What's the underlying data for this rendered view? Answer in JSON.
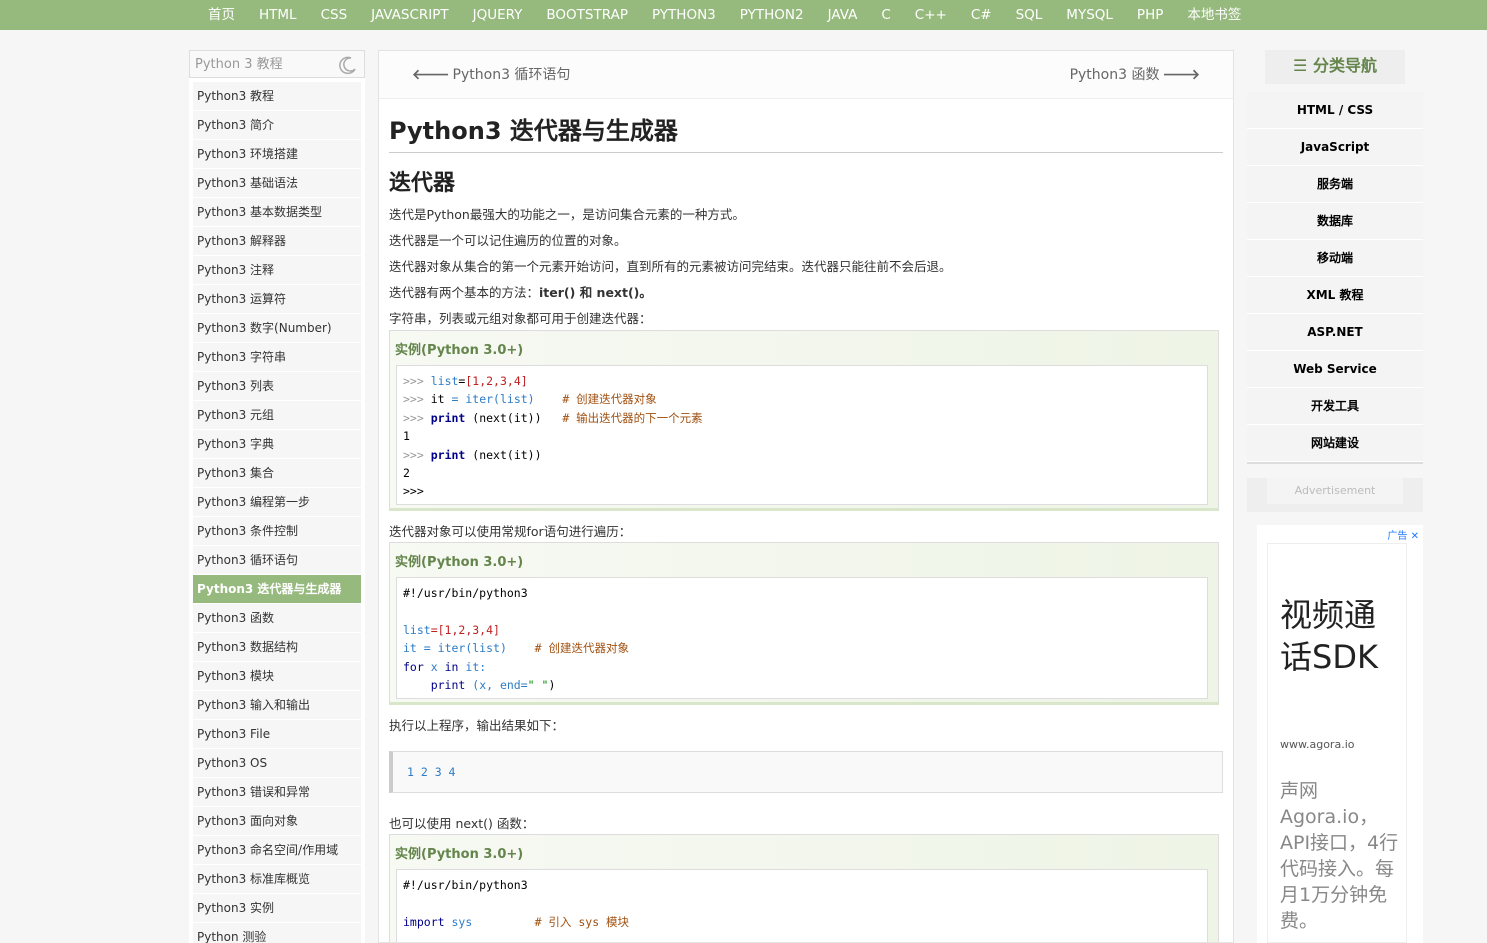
{
  "topnav": [
    "首页",
    "HTML",
    "CSS",
    "JAVASCRIPT",
    "JQUERY",
    "BOOTSTRAP",
    "PYTHON3",
    "PYTHON2",
    "JAVA",
    "C",
    "C++",
    "C#",
    "SQL",
    "MYSQL",
    "PHP",
    "本地书签"
  ],
  "sidebar": {
    "title": "Python 3 教程",
    "items": [
      "Python3 教程",
      "Python3 简介",
      "Python3 环境搭建",
      "Python3 基础语法",
      "Python3 基本数据类型",
      "Python3 解释器",
      "Python3 注释",
      "Python3 运算符",
      "Python3 数字(Number)",
      "Python3 字符串",
      "Python3 列表",
      "Python3 元组",
      "Python3 字典",
      "Python3 集合",
      "Python3 编程第一步",
      "Python3 条件控制",
      "Python3 循环语句",
      "Python3 迭代器与生成器",
      "Python3 函数",
      "Python3 数据结构",
      "Python3 模块",
      "Python3 输入和输出",
      "Python3 File",
      "Python3 OS",
      "Python3 错误和异常",
      "Python3 面向对象",
      "Python3 命名空间/作用域",
      "Python3 标准库概览",
      "Python3 实例",
      "Python 测验"
    ],
    "active_index": 17
  },
  "main": {
    "prev": "Python3 循环语句",
    "next": "Python3 函数",
    "title": "Python3 迭代器与生成器",
    "section": "迭代器",
    "p1": "迭代是Python最强大的功能之一，是访问集合元素的一种方式。",
    "p2": "迭代器是一个可以记住遍历的位置的对象。",
    "p3": "迭代器对象从集合的第一个元素开始访问，直到所有的元素被访问完结束。迭代器只能往前不会后退。",
    "p4_prefix": "迭代器有两个基本的方法：",
    "p4_bold": "iter() 和 next()。",
    "p5": "字符串，列表或元组对象都可用于创建迭代器：",
    "example_label": "实例(Python 3.0+)",
    "p6": "迭代器对象可以使用常规for语句进行遍历：",
    "p7": "执行以上程序，输出结果如下：",
    "output": "1 2 3 4",
    "p8": "也可以使用 next() 函数："
  },
  "code1": {
    "prompt": ">>>",
    "l1_var": "list",
    "l1_eq": "=",
    "l1_list": "[1,2,3,4]",
    "l2_it": "it",
    "l2_rest": "= iter(list)",
    "l2_cm": "# 创建迭代器对象",
    "l3_kw": "print",
    "l3_rest": "(next(it))",
    "l3_cm": "# 输出迭代器的下一个元素",
    "out1": "1",
    "l5_kw": "print",
    "l5_rest": "(next(it))",
    "out2": "2"
  },
  "code2": {
    "shebang": "#!/usr/bin/python3",
    "l2_var": "list",
    "l2_list": "=[1,2,3,4]",
    "l3_it": "it",
    "l3_rest": "= iter(list)",
    "l3_cm": "# 创建迭代器对象",
    "l4_for": "for",
    "l4_x": "x",
    "l4_in": "in",
    "l4_it": "it:",
    "l5_print": "print",
    "l5_args": "(x, end=",
    "l5_str": "\" \"",
    "l5_close": ")"
  },
  "code3": {
    "shebang": "#!/usr/bin/python3",
    "l2_import": "import",
    "l2_sys": "sys",
    "l2_cm": "# 引入 sys 模块"
  },
  "rside": {
    "nav_title": "分类导航",
    "nav_items": [
      "HTML / CSS",
      "JavaScript",
      "服务端",
      "数据库",
      "移动端",
      "XML 教程",
      "ASP.NET",
      "Web Service",
      "开发工具",
      "网站建设"
    ],
    "adv_label": "Advertisement",
    "ad_badge": "广告",
    "ad_close": "✕",
    "ad_title": "视频通话SDK",
    "ad_url": "www.agora.io",
    "ad_desc": "声网Agora.io，API接口，4行代码接入。每月1万分钟免费。"
  }
}
